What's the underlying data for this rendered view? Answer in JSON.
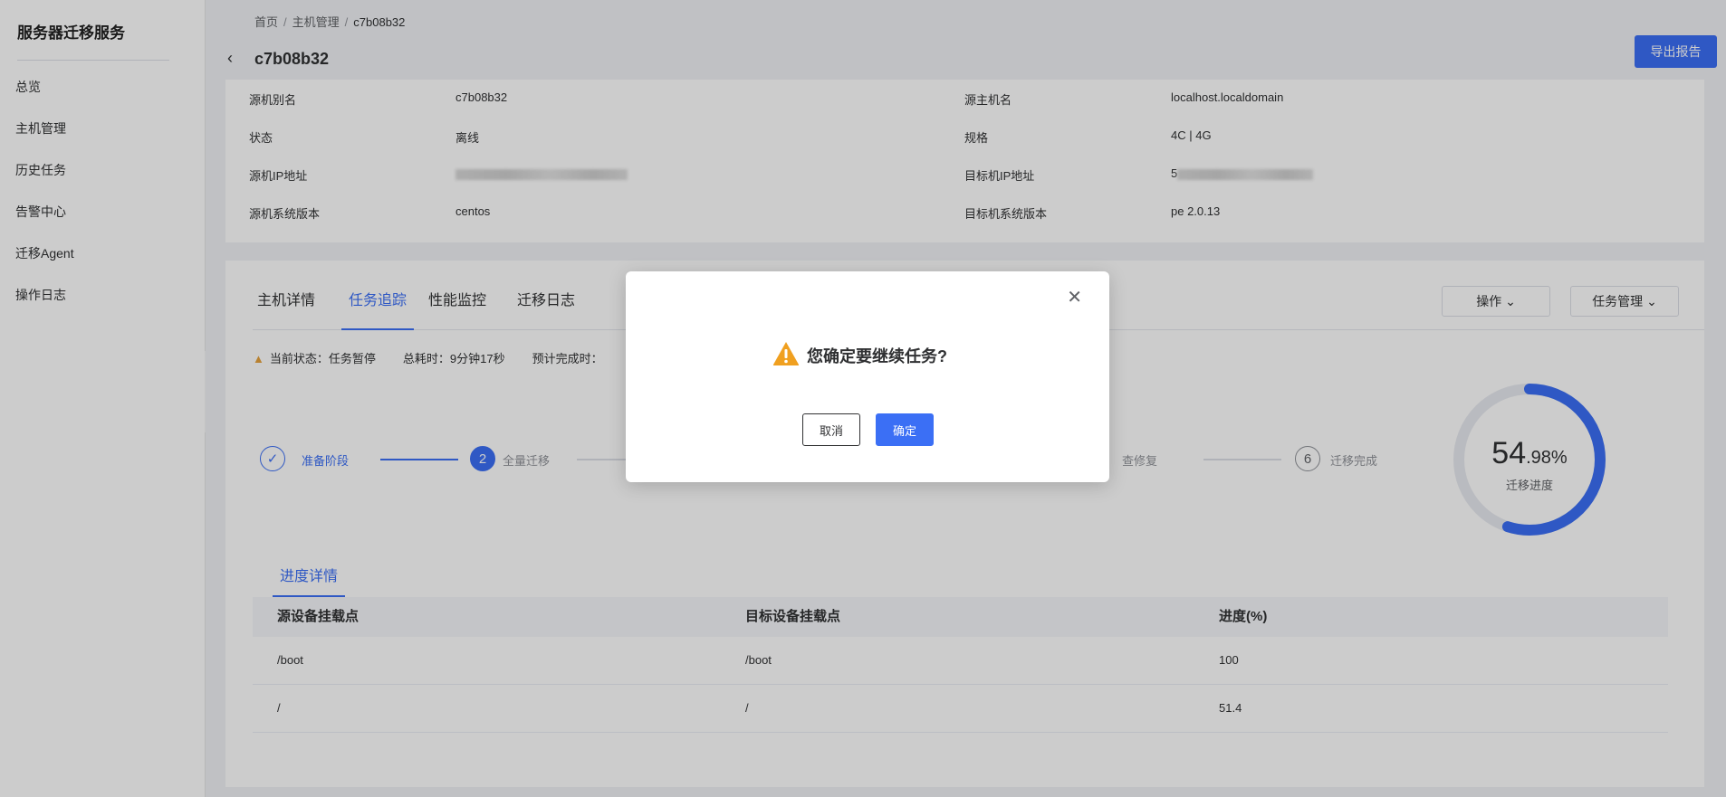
{
  "sidebar": {
    "title": "服务器迁移服务",
    "items": [
      {
        "label": "总览"
      },
      {
        "label": "主机管理"
      },
      {
        "label": "历史任务"
      },
      {
        "label": "告警中心"
      },
      {
        "label": "迁移Agent"
      },
      {
        "label": "操作日志"
      }
    ]
  },
  "header": {
    "breadcrumb": [
      "首页",
      "主机管理",
      "c7b08b32"
    ],
    "title": "c7b08b32",
    "export_label": "导出报告"
  },
  "info": {
    "left": [
      {
        "label": "源机别名",
        "value": "c7b08b32"
      },
      {
        "label": "状态",
        "value": "离线"
      },
      {
        "label": "源机IP地址",
        "value": ""
      },
      {
        "label": "源机系统版本",
        "value": "centos"
      }
    ],
    "right": [
      {
        "label": "源主机名",
        "value": "localhost.localdomain"
      },
      {
        "label": "规格",
        "value": "4C | 4G"
      },
      {
        "label": "目标机IP地址",
        "value": "5"
      },
      {
        "label": "目标机系统版本",
        "value": "pe 2.0.13"
      }
    ]
  },
  "tabs": [
    {
      "label": "主机详情"
    },
    {
      "label": "任务追踪"
    },
    {
      "label": "性能监控"
    },
    {
      "label": "迁移日志"
    }
  ],
  "actions": {
    "operate": "操作 ⌄",
    "task_manage": "任务管理 ⌄"
  },
  "status": {
    "current": "当前状态：任务暂停",
    "elapsed": "总耗时：9分钟17秒",
    "eta": "预计完成时："
  },
  "steps": [
    {
      "label": "准备阶段",
      "num": "✓"
    },
    {
      "label": "全量迁移",
      "num": "2"
    },
    {
      "label": "查修复",
      "num": ""
    },
    {
      "label": "迁移完成",
      "num": "6"
    }
  ],
  "progress": {
    "int": "54",
    "dec": ".98",
    "unit": "%",
    "caption": "迁移进度",
    "value": 54.98
  },
  "detail_tab": "进度详情",
  "table": {
    "headers": [
      "源设备挂载点",
      "目标设备挂载点",
      "进度(%)"
    ],
    "rows": [
      [
        "/boot",
        "/boot",
        "100"
      ],
      [
        "/",
        "/",
        "51.4"
      ]
    ]
  },
  "modal": {
    "message": "您确定要继续任务?",
    "cancel": "取消",
    "ok": "确定"
  },
  "colors": {
    "accent": "#3b6ff5",
    "warning": "#f0a020"
  }
}
